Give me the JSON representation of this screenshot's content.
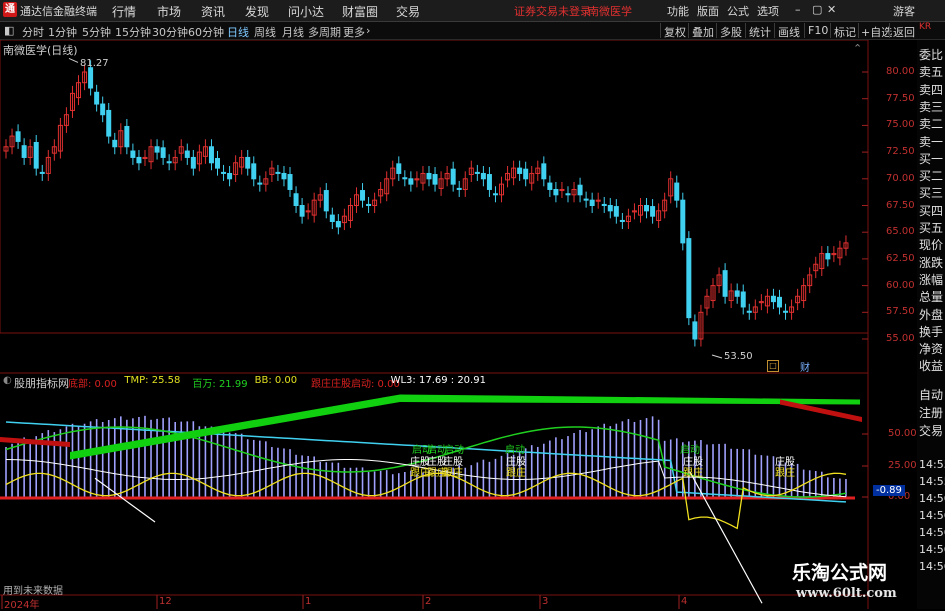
{
  "app": {
    "title": "通达信金融终端",
    "login_status": "证券交易未登录",
    "stock_name_header": "南微医学",
    "guest": "游客"
  },
  "menu": {
    "items": [
      "行情",
      "市场",
      "资讯",
      "发现",
      "问小达",
      "财富圈",
      "交易"
    ],
    "right": [
      "功能",
      "版面",
      "公式",
      "选项"
    ]
  },
  "period_bar": {
    "periods": [
      "分时",
      "1分钟",
      "5分钟",
      "15分钟",
      "30分钟",
      "60分钟",
      "日线",
      "周线",
      "月线",
      "多周期",
      "更多"
    ],
    "active": "日线",
    "tools": [
      "复权",
      "叠加",
      "多股",
      "统计",
      "画线",
      "F10",
      "标记",
      "+自选",
      "返回"
    ]
  },
  "main_chart": {
    "title": "南微医学(日线)",
    "y_ticks": [
      "80.00",
      "77.50",
      "75.00",
      "72.50",
      "70.00",
      "67.50",
      "65.00",
      "62.50",
      "60.00",
      "57.50",
      "55.00"
    ],
    "high_label": "81.27",
    "low_label": "53.50",
    "finance_label": "财"
  },
  "indicator": {
    "name": "股朋指标网",
    "params": [
      {
        "label": "底部: 0.00",
        "color": "#d82020"
      },
      {
        "label": "TMP: 25.58",
        "color": "#e0e020"
      },
      {
        "label": "百万: 21.99",
        "color": "#20d020"
      },
      {
        "label": "BB: 0.00",
        "color": "#e0e020"
      },
      {
        "label": "跟庄庄股启动: 0.00",
        "color": "#d82020"
      },
      {
        "label": "WL3: 17.69 : 20.91",
        "color": "#ffffff"
      }
    ],
    "y_ticks": [
      "50.00",
      "25.00",
      "0.00"
    ],
    "current_value": "-0.89",
    "markers": [
      {
        "text": "启动"
      },
      {
        "text": "启动"
      },
      {
        "text": "启动"
      },
      {
        "text": "启动"
      },
      {
        "text": "启动"
      },
      {
        "text": "庄股"
      },
      {
        "text": "庄股"
      },
      {
        "text": "庄股"
      },
      {
        "text": "庄股"
      },
      {
        "text": "庄股"
      },
      {
        "text": "庄股"
      },
      {
        "text": "跟庄"
      },
      {
        "text": "跟庄"
      },
      {
        "text": "跟庄"
      },
      {
        "text": "跟庄"
      },
      {
        "text": "跟庄"
      },
      {
        "text": "跟庄"
      }
    ],
    "future_data_note": "用到未来数据"
  },
  "x_axis": {
    "labels": [
      "2024年",
      "12",
      "1",
      "2",
      "3",
      "4"
    ]
  },
  "side_panel": {
    "top_code": "KR",
    "labels": [
      "委比",
      "卖五",
      "卖四",
      "卖三",
      "卖二",
      "卖一",
      "买一",
      "买二",
      "买三",
      "买四",
      "买五",
      "现价",
      "涨跌",
      "涨幅",
      "总量",
      "外盘",
      "换手",
      "净资",
      "收益"
    ],
    "lower_labels": [
      "自动",
      "注册",
      "交易"
    ],
    "times": [
      "14:55",
      "14:55",
      "14:56",
      "14:56",
      "14:56",
      "14:56",
      "14:56"
    ]
  },
  "watermark": {
    "title": "乐淘公式网",
    "url": "www.60lt.com"
  }
}
